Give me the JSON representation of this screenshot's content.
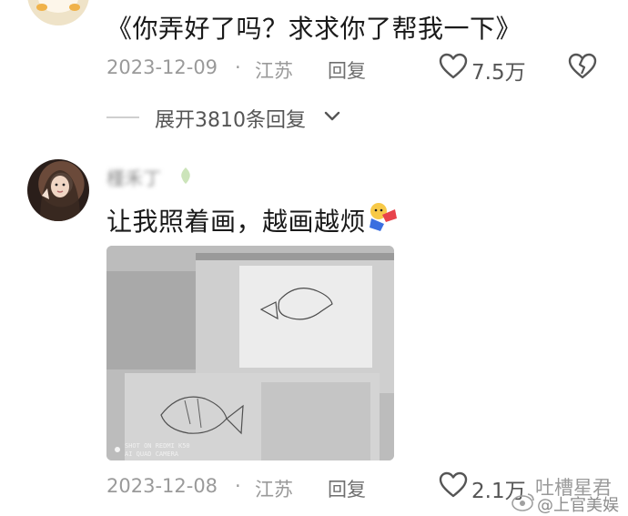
{
  "comment_1": {
    "text": "《你弄好了吗？求求你了帮我一下》",
    "date": "2023-12-09",
    "location": "江苏",
    "reply_label": "回复",
    "like_count": "7.5万",
    "expand_replies": "展开3810条回复"
  },
  "comment_2": {
    "username": "槿禾丁",
    "text": "让我照着画，越画越烦",
    "date": "2023-12-08",
    "location": "江苏",
    "reply_label": "回复",
    "like_count": "2.1万",
    "photo_caption_line1": "SHOT ON REDMI K50",
    "photo_caption_line2": "AI QUAD CAMERA"
  },
  "separator": "·",
  "watermark": {
    "left_text": "吐槽星君",
    "right_text": "@上官美娱"
  },
  "colors": {
    "text": "#1a1a1a",
    "meta": "#9a9a9a",
    "icon": "#555555"
  },
  "icons": [
    "heart-outline-icon",
    "broken-heart-icon",
    "chevron-down-icon",
    "emoji-sticker-icon",
    "weibo-logo-icon"
  ]
}
